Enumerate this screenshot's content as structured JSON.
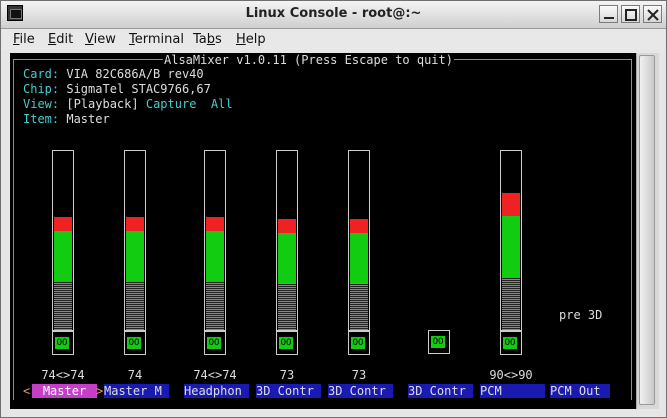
{
  "window": {
    "title": "Linux Console - root@:~"
  },
  "menu": [
    {
      "label": "File",
      "u": "F",
      "rest": "ile"
    },
    {
      "label": "Edit",
      "u": "E",
      "rest": "dit"
    },
    {
      "label": "View",
      "u": "V",
      "rest": "iew"
    },
    {
      "label": "Terminal",
      "u": "T",
      "rest": "erminal"
    },
    {
      "label": "Tabs",
      "u": "b",
      "pre": "Ta",
      "rest": "s"
    },
    {
      "label": "Help",
      "u": "H",
      "rest": "elp"
    }
  ],
  "mixer": {
    "header": "AlsaMixer v1.0.11 (Press Escape to quit)",
    "card_label": "Card:",
    "card_value": "VIA 82C686A/B rev40",
    "chip_label": "Chip:",
    "chip_value": "SigmaTel STAC9766,67",
    "view_label": "View:",
    "view_playback": "[Playback]",
    "view_capture": "Capture",
    "view_all": "All",
    "item_label": "Item:",
    "item_value": "Master",
    "pre3d": "pre 3D",
    "mute_text": "OO",
    "channels": [
      {
        "name": "Master",
        "volume": "74<>74",
        "level": 0.74,
        "selected": true
      },
      {
        "name": "Master M",
        "volume": "74",
        "level": 0.74
      },
      {
        "name": "Headphon",
        "volume": "74<>74",
        "level": 0.74
      },
      {
        "name": "3D Contr",
        "volume": "73",
        "level": 0.73
      },
      {
        "name": "3D Contr",
        "volume": "73",
        "level": 0.73
      },
      {
        "name": "3D Contr",
        "volume": "",
        "level": 0
      },
      {
        "name": "PCM",
        "volume": "90<>90",
        "level": 0.9
      },
      {
        "name": "PCM Out",
        "volume": "",
        "level": 0
      }
    ]
  }
}
